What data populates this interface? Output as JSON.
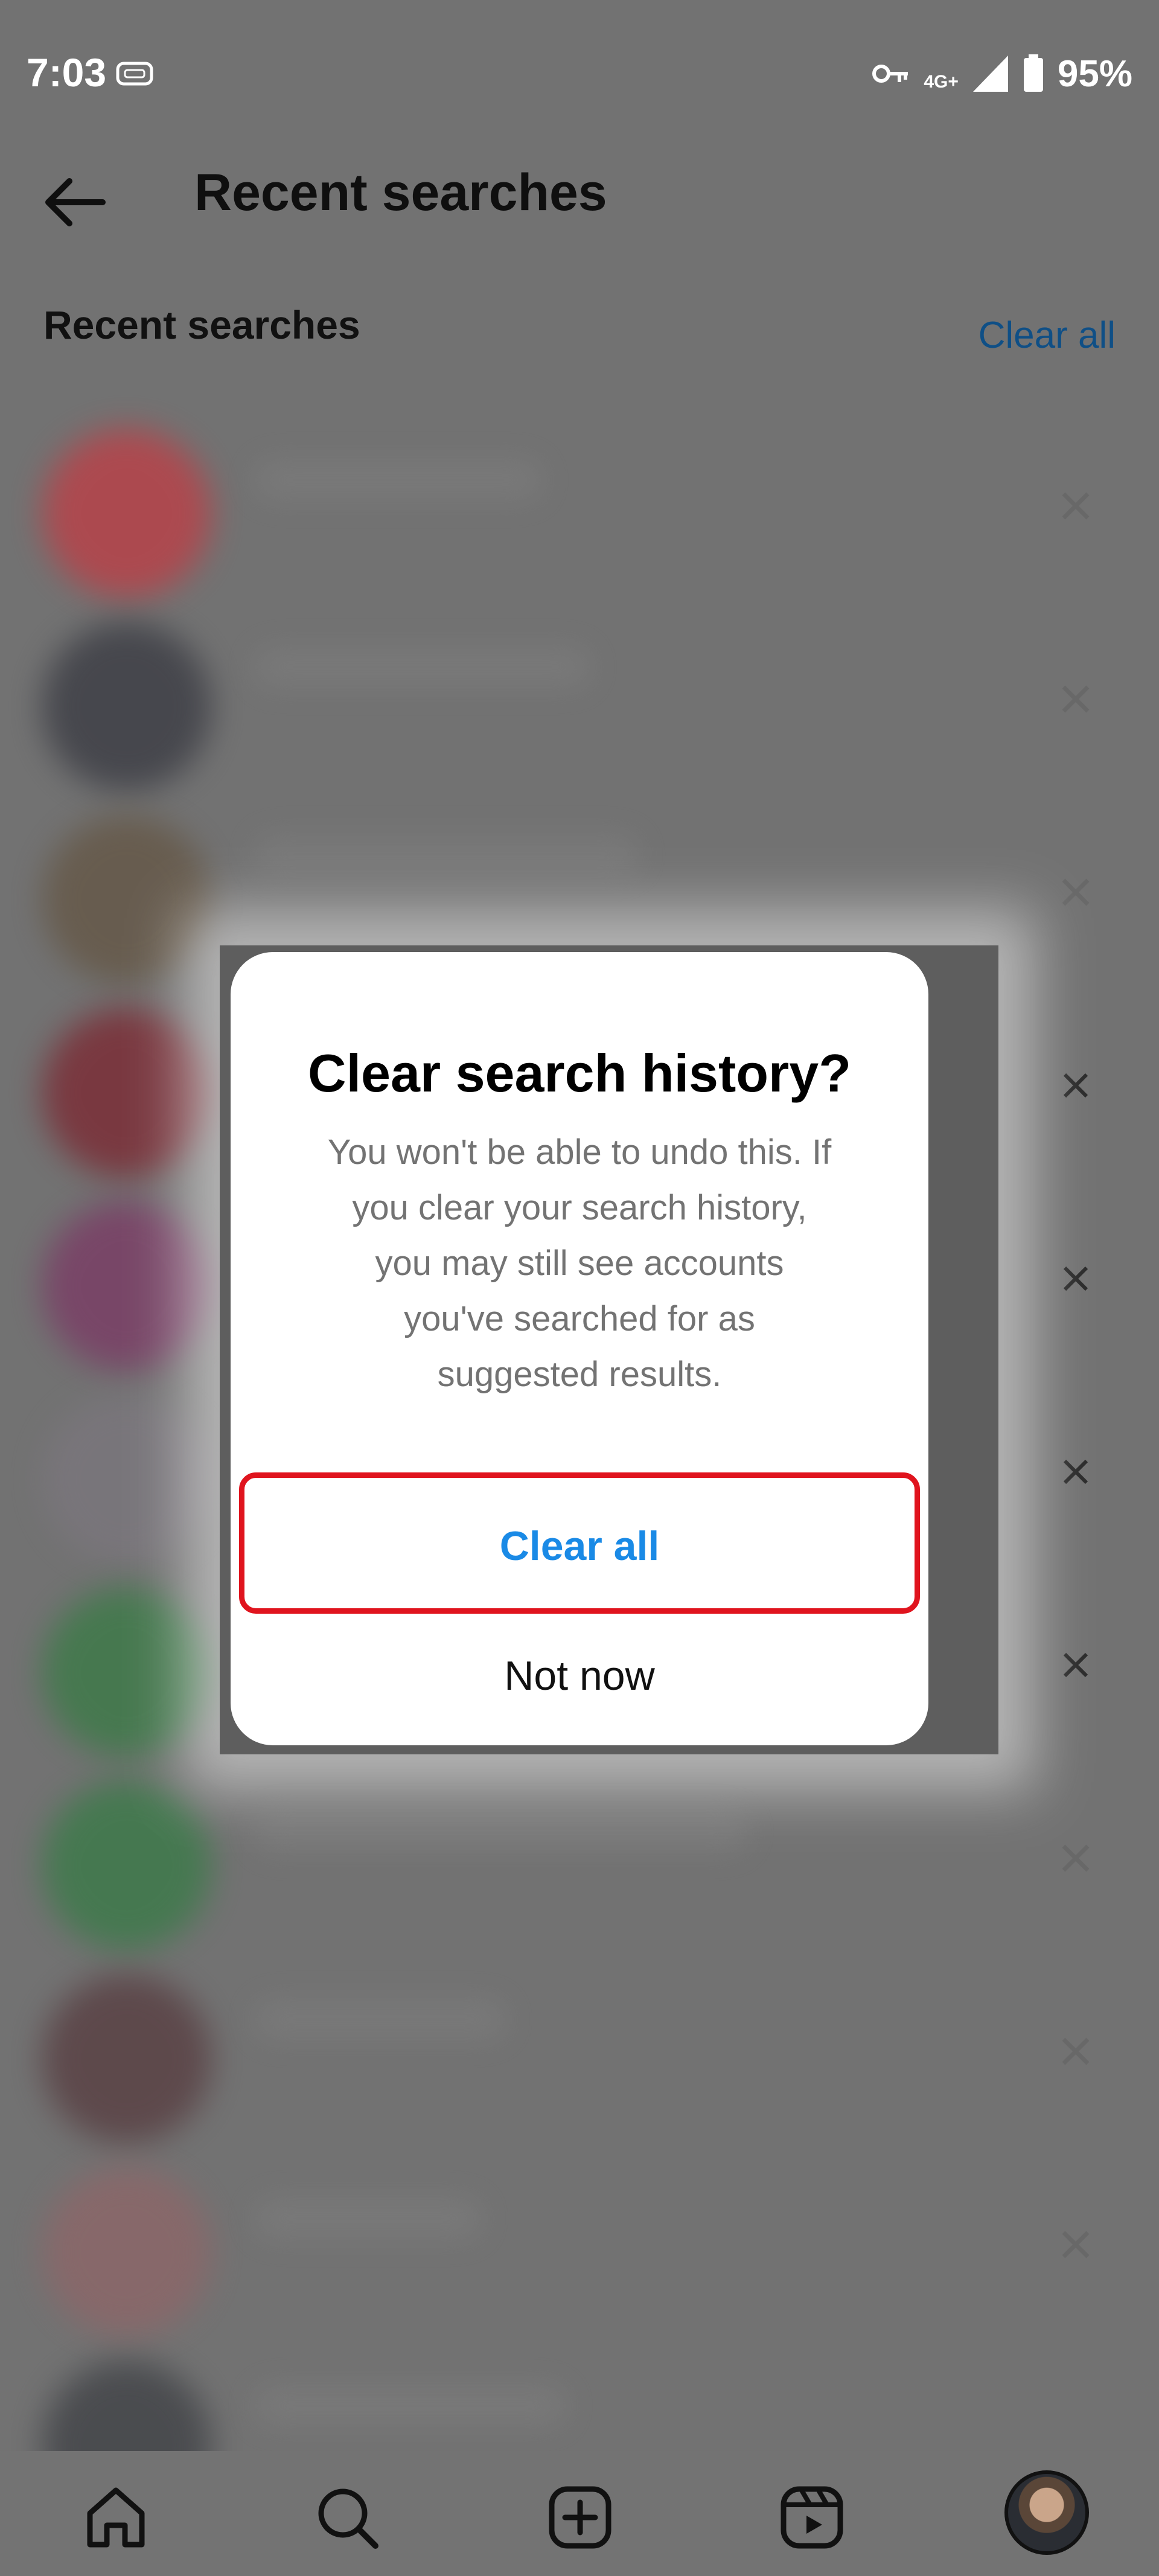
{
  "status_bar": {
    "time": "7:03",
    "network": "4G+",
    "battery": "95%",
    "icons": [
      "ticket-icon",
      "key-icon",
      "signal-icon",
      "battery-icon"
    ]
  },
  "header": {
    "title": "Recent searches",
    "back_icon": "arrow-left-icon"
  },
  "section": {
    "title": "Recent searches",
    "clear_all": "Clear all"
  },
  "list": {
    "avatar_colors": [
      "#b7434a",
      "#3f4047",
      "#665949",
      "#7b2f38",
      "#7a3f66",
      "#7a767c",
      "#3f7a4a",
      "#3e7a4b",
      "#5a4245",
      "#8b6769",
      "#44464a"
    ],
    "remove_icon": "close-icon"
  },
  "dialog": {
    "title": "Clear search history?",
    "body": "You won't be able to undo this. If you clear your search history, you may still see accounts you've searched for as suggested results.",
    "confirm_label": "Clear all",
    "cancel_label": "Not now"
  },
  "bottom_nav": {
    "items": [
      "home-icon",
      "search-icon",
      "add-post-icon",
      "reels-icon",
      "profile-avatar"
    ]
  },
  "colors": {
    "accent": "#1a8ae6",
    "highlight_border": "#e0141e",
    "overlay": "#727272"
  }
}
